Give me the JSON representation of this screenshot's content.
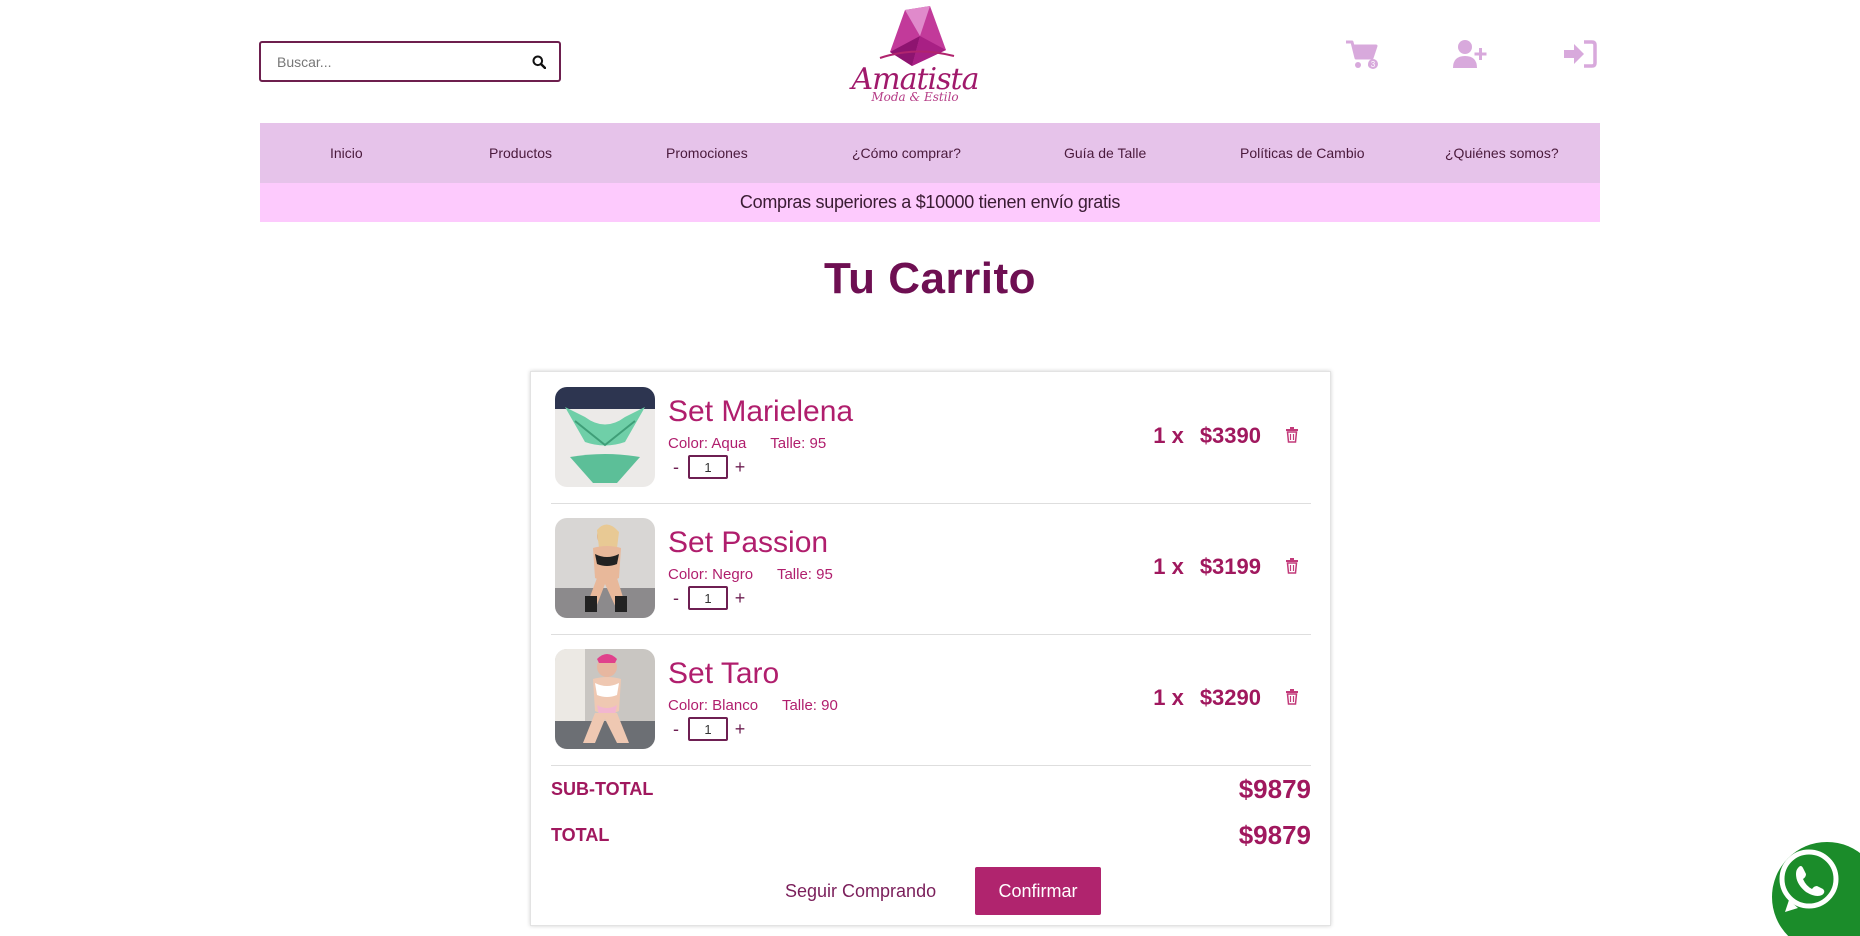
{
  "header": {
    "search_placeholder": "Buscar...",
    "logo_text": "Amatista",
    "logo_subtitle": "Moda & Estilo"
  },
  "nav": {
    "items": [
      "Inicio",
      "Productos",
      "Promociones",
      "¿Cómo comprar?",
      "Guía de Talle",
      "Políticas de Cambio",
      "¿Quiénes somos?"
    ]
  },
  "promo": "Compras superiores a $10000 tienen envío gratis",
  "page_title": "Tu Carrito",
  "cart": {
    "items": [
      {
        "name": "Set Marielena",
        "color": "Color: Aqua",
        "size": "Talle: 95",
        "qty": "1",
        "mult": "1 x",
        "price": "$3390"
      },
      {
        "name": "Set Passion",
        "color": "Color: Negro",
        "size": "Talle: 95",
        "qty": "1",
        "mult": "1 x",
        "price": "$3199"
      },
      {
        "name": "Set Taro",
        "color": "Color: Blanco",
        "size": "Talle: 90",
        "qty": "1",
        "mult": "1 x",
        "price": "$3290"
      }
    ],
    "subtotal_label": "SUB-TOTAL",
    "subtotal_value": "$9879",
    "total_label": "TOTAL",
    "total_value": "$9879",
    "minus": "-",
    "plus": "+",
    "keep_shopping": "Seguir Comprando",
    "confirm": "Confirmar"
  },
  "colors": {
    "accent": "#b0246e",
    "nav_bg": "#e6c3ea",
    "promo_bg": "#fdcafd",
    "title": "#6e0f52",
    "whatsapp": "#1b8c2a"
  },
  "icons": [
    "search-icon",
    "cart-icon",
    "user-plus-icon",
    "sign-in-icon",
    "trash-icon",
    "whatsapp-icon"
  ]
}
